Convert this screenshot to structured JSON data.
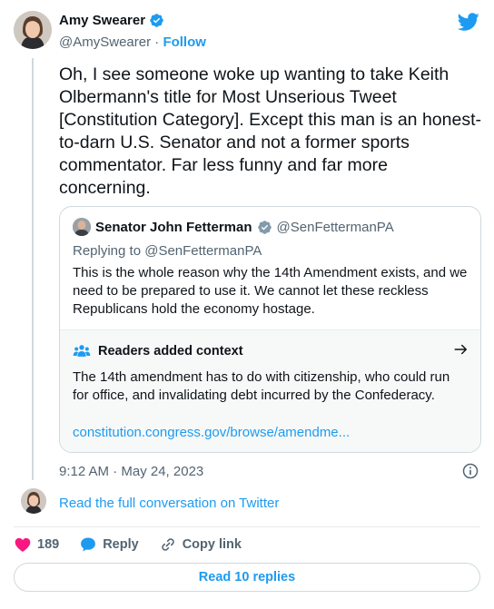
{
  "author": {
    "name": "Amy Swearer",
    "handle": "@AmySwearer",
    "separator": "·",
    "follow_label": "Follow"
  },
  "tweet": {
    "text": "Oh, I see someone woke up wanting to take Keith Olbermann's title for Most Unserious Tweet [Constitution Category]. Except this man is an honest-to-darn U.S. Senator and not a former sports commentator. Far less funny and far more concerning."
  },
  "quoted": {
    "name": "Senator John Fetterman",
    "handle": "@SenFettermanPA",
    "replying_to": "Replying to @SenFettermanPA",
    "text": "This is the whole reason why the 14th Amendment exists, and we need to be prepared to use it. We cannot let these reckless Republicans hold the economy hostage.",
    "context": {
      "title": "Readers added context",
      "body": "The 14th amendment has to do with citizenship, who could run for office, and invalidating debt incurred by the Confederacy.",
      "link": "constitution.congress.gov/browse/amendme..."
    }
  },
  "timestamp": "9:12 AM · May 24, 2023",
  "read_conversation": "Read the full conversation on Twitter",
  "actions": {
    "likes": "189",
    "reply_label": "Reply",
    "copy_label": "Copy link"
  },
  "read_replies": "Read 10 replies",
  "colors": {
    "accent": "#1d9bf0",
    "like": "#f91880",
    "secondary_text": "#536471"
  },
  "icons": [
    "verified-badge-icon",
    "twitter-bird-icon",
    "readers-context-icon",
    "arrow-right-icon",
    "info-icon",
    "heart-icon",
    "reply-bubble-icon",
    "link-icon"
  ]
}
